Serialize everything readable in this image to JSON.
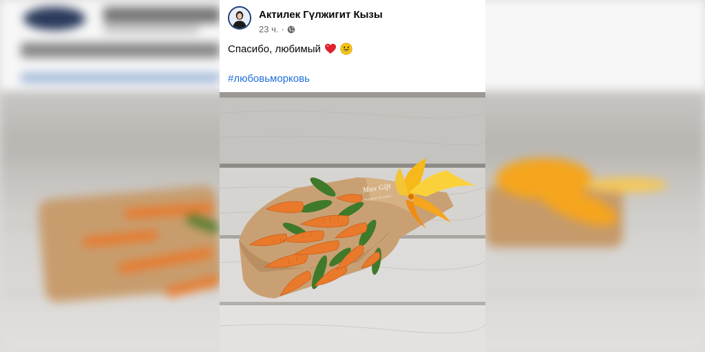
{
  "post": {
    "author": "Актилек Гүлжигит Кызы",
    "time": "23 ч.",
    "separator": "·",
    "privacy_icon": "globe-icon",
    "text": "Спасибо, любимый",
    "emojis": [
      "heart-icon",
      "smiley-icon"
    ],
    "hashtag": "#любовьморковь"
  },
  "photo": {
    "watermark_brand": "Max Gift",
    "watermark_tagline": "подарки на заказ"
  },
  "colors": {
    "link": "#216fdb",
    "meta": "#65676b",
    "avatar_ring": "#1e3a78",
    "carrot": "#e9792b",
    "kraft_paper": "#c9a073",
    "lily": "#f7b81a"
  }
}
